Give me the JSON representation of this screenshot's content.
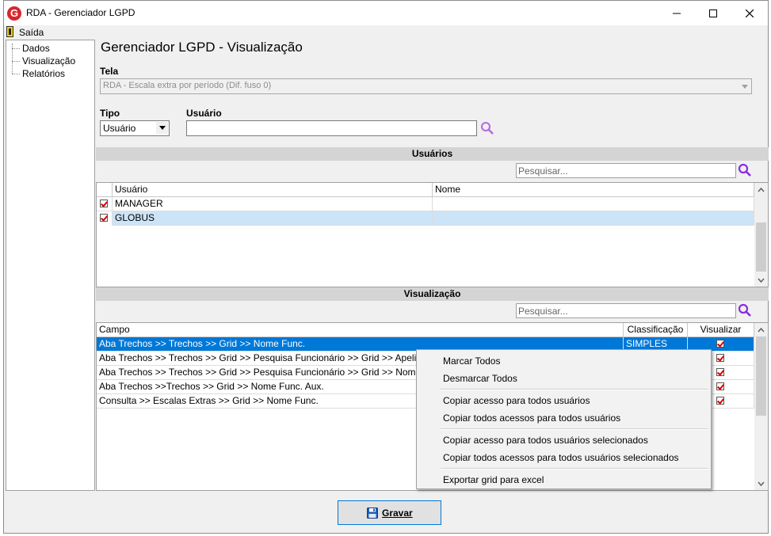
{
  "window": {
    "title": "RDA - Gerenciador LGPD",
    "app_icon_letter": "G"
  },
  "menu": {
    "exit_label": "Saída"
  },
  "tree": {
    "items": [
      "Dados",
      "Visualização",
      "Relatórios"
    ]
  },
  "page": {
    "title": "Gerenciador LGPD - Visualização"
  },
  "form": {
    "tela_label": "Tela",
    "tela_value": "RDA - Escala extra por período (Dif. fuso 0)",
    "tipo_label": "Tipo",
    "tipo_value": "Usuário",
    "usuario_label": "Usuário",
    "usuario_value": ""
  },
  "users_section": {
    "header": "Usuários",
    "search_placeholder": "Pesquisar...",
    "columns": [
      "Usuário",
      "Nome"
    ],
    "rows": [
      {
        "usuario": "MANAGER",
        "nome": "",
        "checked": true,
        "selected": false
      },
      {
        "usuario": "GLOBUS",
        "nome": "",
        "checked": true,
        "selected": true
      }
    ]
  },
  "view_section": {
    "header": "Visualização",
    "search_placeholder": "Pesquisar...",
    "columns": [
      "Campo",
      "Classificação",
      "Visualizar"
    ],
    "rows": [
      {
        "campo": "Aba Trechos >> Trechos >> Grid >> Nome Func.",
        "classificacao": "SIMPLES",
        "visualizar": true,
        "selected": true
      },
      {
        "campo": "Aba Trechos >> Trechos >> Grid >> Pesquisa Funcionário >> Grid >> Apelido",
        "classificacao": "",
        "visualizar": true,
        "selected": false
      },
      {
        "campo": "Aba Trechos >> Trechos >> Grid >> Pesquisa Funcionário >> Grid >> Nome",
        "classificacao": "",
        "visualizar": true,
        "selected": false
      },
      {
        "campo": "Aba Trechos >>Trechos >> Grid >> Nome Func. Aux.",
        "classificacao": "",
        "visualizar": true,
        "selected": false
      },
      {
        "campo": "Consulta >> Escalas Extras >> Grid >> Nome Func.",
        "classificacao": "",
        "visualizar": true,
        "selected": false
      }
    ]
  },
  "context_menu": {
    "items": [
      "Marcar Todos",
      "Desmarcar Todos",
      "Copiar acesso para todos usuários",
      "Copiar todos acessos para todos usuários",
      "Copiar acesso para todos usuários selecionados",
      "Copiar todos acessos para todos usuários selecionados",
      "Exportar grid para excel"
    ]
  },
  "footer": {
    "save_label": "Gravar"
  },
  "colors": {
    "selection": "#0078d7",
    "selection_light": "#cce4f7",
    "accent_search": "#8a2be2",
    "check": "#d20000"
  }
}
